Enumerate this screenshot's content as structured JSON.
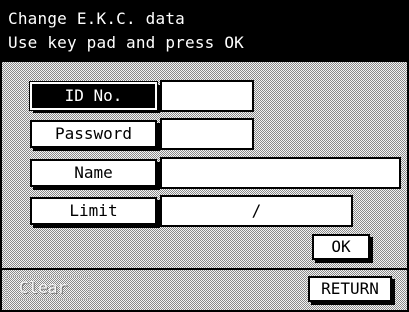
{
  "header": {
    "line1": "Change E.K.C. data",
    "line2": "Use key pad and press OK"
  },
  "form": {
    "rows": [
      {
        "label": "ID No.",
        "value": "",
        "active": true
      },
      {
        "label": "Password",
        "value": ""
      },
      {
        "label": "Name",
        "value": ""
      },
      {
        "label": "Limit",
        "value": "/"
      }
    ]
  },
  "buttons": {
    "ok": "OK",
    "clear": "Clear",
    "return": "RETURN"
  }
}
